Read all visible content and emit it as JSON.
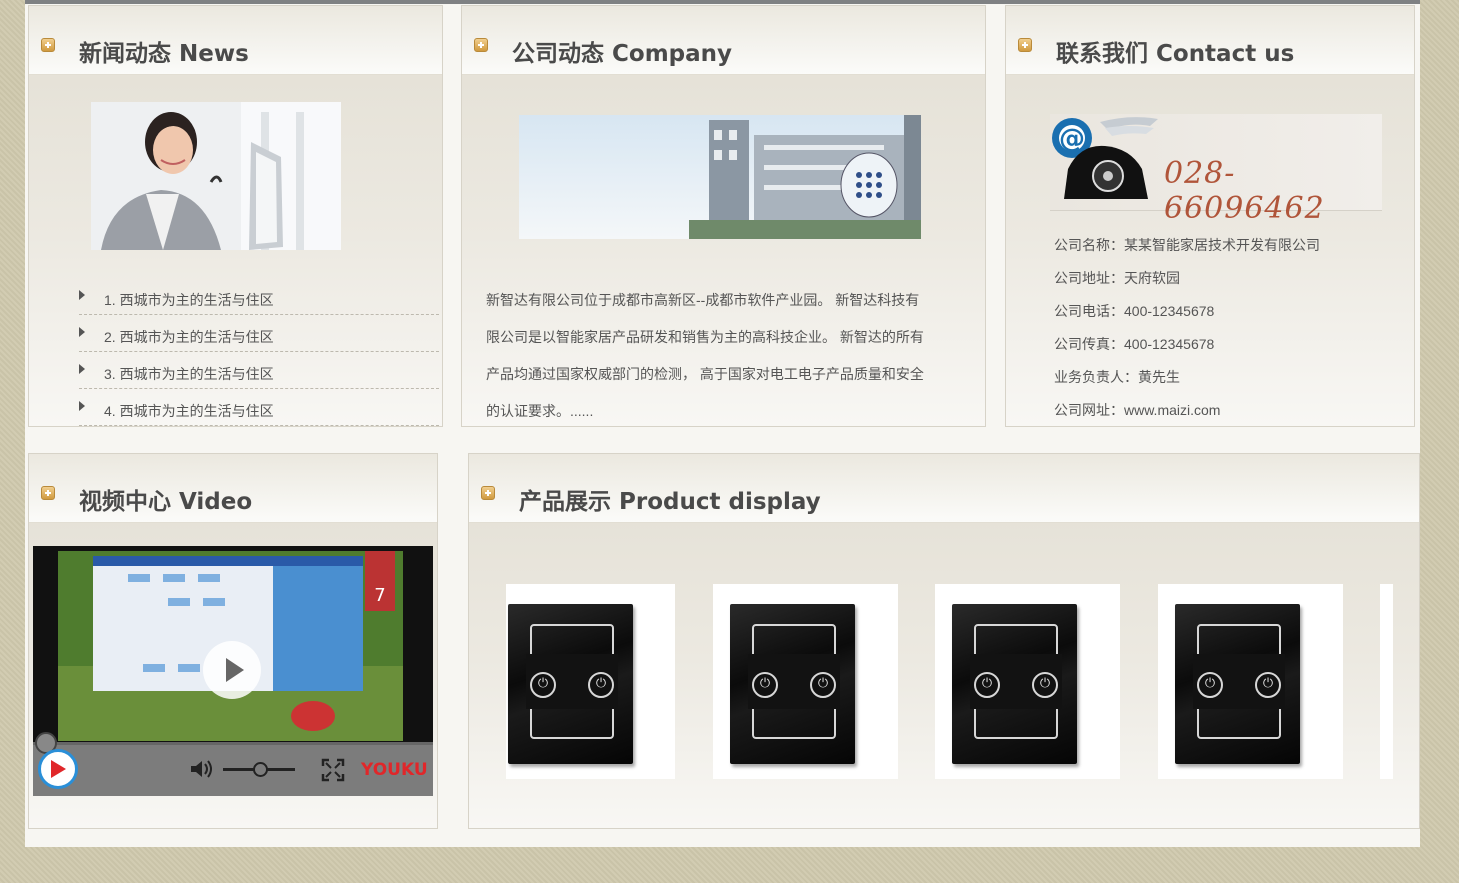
{
  "news": {
    "title": "新闻动态 News",
    "items": [
      "1. 西城市为主的生活与住区",
      "2. 西城市为主的生活与住区",
      "3. 西城市为主的生活与住区",
      "4. 西城市为主的生活与住区"
    ]
  },
  "company": {
    "title": "公司动态 Company",
    "lines": [
      "新智达有限公司位于成都市高新区--成都市软件产业园。 新智达科技有",
      "限公司是以智能家居产品研发和销售为主的高科技企业。 新智达的所有",
      "产品均通过国家权威部门的检测， 高于国家对电工电子产品质量和安全",
      "的认证要求。......"
    ]
  },
  "contact": {
    "title": "联系我们 Contact us",
    "phone_banner": "028-66096462",
    "rows": [
      "公司名称：某某智能家居技术开发有限公司",
      "公司地址：天府软园",
      "公司电话：400-12345678",
      "公司传真：400-12345678",
      "业务负责人：黄先生",
      "公司网址：www.maizi.com"
    ]
  },
  "video": {
    "title": "视频中心 Video",
    "brand": "YOUKU",
    "icons": [
      "play-icon",
      "volume-icon",
      "fullscreen-icon"
    ]
  },
  "product": {
    "title": "产品展示 Product display"
  },
  "colors": {
    "accent": "#d09a3f",
    "title": "#4a4a4a",
    "phone": "#b0553a"
  }
}
